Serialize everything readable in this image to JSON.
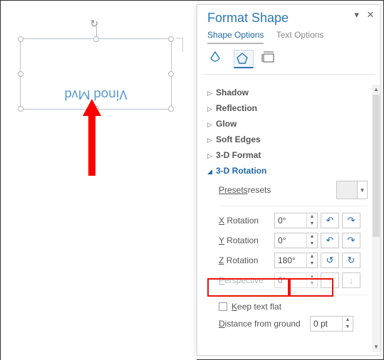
{
  "canvas": {
    "text": "Vinod Mvd"
  },
  "pane": {
    "title": "Format Shape",
    "tabs": {
      "shape": "Shape Options",
      "text": "Text Options"
    },
    "sections": {
      "shadow": "Shadow",
      "reflection": "Reflection",
      "glow": "Glow",
      "soft_edges": "Soft Edges",
      "format3d": "3-D Format",
      "rotation3d": "3-D Rotation"
    },
    "rotation": {
      "presets_label": "Presets",
      "x": {
        "label_u": "X",
        "label_r": " Rotation",
        "value": "0°"
      },
      "y": {
        "label_u": "Y",
        "label_r": " Rotation",
        "value": "0°"
      },
      "z": {
        "label_u": "Z",
        "label_r": " Rotation",
        "value": "180°"
      },
      "perspective": {
        "label_u": "P",
        "label_r": "erspective",
        "value": "0°"
      },
      "keep_flat": {
        "label_u": "K",
        "label_r": "eep text flat"
      },
      "distance": {
        "label_u": "D",
        "label_r": "istance from ground",
        "value": "0 pt"
      }
    }
  }
}
